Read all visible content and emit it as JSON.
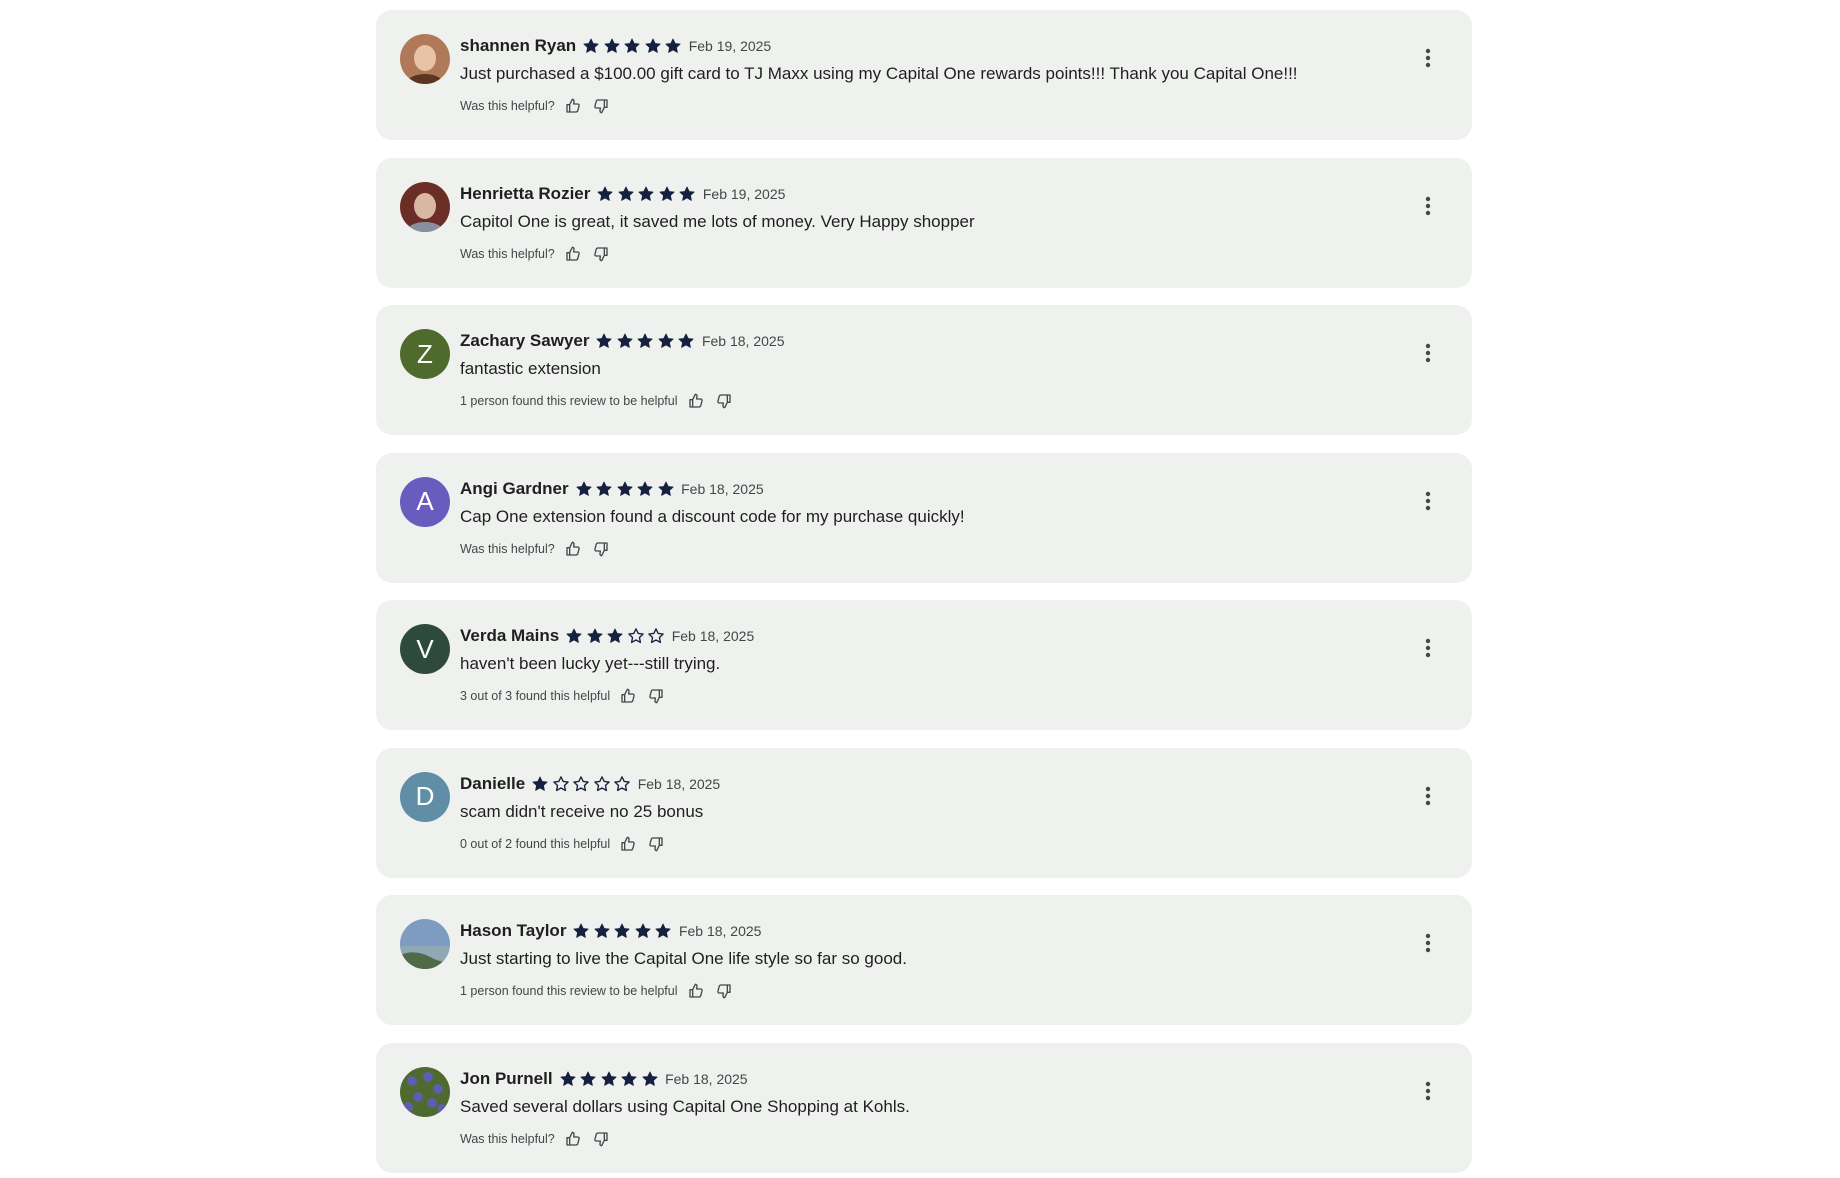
{
  "colors": {
    "card_background": "#eff1ef",
    "star_color": "#16213f",
    "text_primary": "#1f1f1f",
    "text_secondary": "#444746"
  },
  "reviews": [
    {
      "name": "shannen Ryan",
      "rating": 5,
      "date": "Feb 19, 2025",
      "text": "Just purchased a $100.00 gift card to TJ Maxx using my Capital One rewards points!!!  Thank you Capital One!!!",
      "helpful": "Was this helpful?",
      "avatar": {
        "type": "photo",
        "label": "woman-portrait",
        "bg": "#b07a5a",
        "fg": "#5a3521"
      }
    },
    {
      "name": "Henrietta Rozier",
      "rating": 5,
      "date": "Feb 19, 2025",
      "text": "Capitol One is great, it saved me lots of money. Very Happy shopper",
      "helpful": "Was this helpful?",
      "avatar": {
        "type": "photo",
        "label": "older-woman-portrait",
        "bg": "#6b2e26",
        "fg": "#d9b8a3"
      }
    },
    {
      "name": "Zachary Sawyer",
      "rating": 5,
      "date": "Feb 18, 2025",
      "text": "fantastic extension",
      "helpful": "1 person found this review to be helpful",
      "avatar": {
        "type": "letter",
        "letter": "Z",
        "bg": "#4e6b2d"
      }
    },
    {
      "name": "Angi Gardner",
      "rating": 5,
      "date": "Feb 18, 2025",
      "text": "Cap One extension found a discount code for my purchase quickly!",
      "helpful": "Was this helpful?",
      "avatar": {
        "type": "letter",
        "letter": "A",
        "bg": "#6a5bbf"
      }
    },
    {
      "name": "Verda Mains",
      "rating": 3,
      "date": "Feb 18, 2025",
      "text": "haven't been lucky yet---still trying.",
      "helpful": "3 out of 3 found this helpful",
      "avatar": {
        "type": "letter",
        "letter": "V",
        "bg": "#2e4a3c"
      }
    },
    {
      "name": "Danielle",
      "rating": 1,
      "date": "Feb 18, 2025",
      "text": "scam didn't receive no 25 bonus",
      "helpful": "0 out of 2 found this helpful",
      "avatar": {
        "type": "letter",
        "letter": "D",
        "bg": "#5f8ea6"
      }
    },
    {
      "name": "Hason Taylor",
      "rating": 5,
      "date": "Feb 18, 2025",
      "text": "Just starting to live the Capital One life style so far so good.",
      "helpful": "1 person found this review to be helpful",
      "avatar": {
        "type": "photo",
        "label": "landscape-photo",
        "bg": "#7e9cc2",
        "fg": "#4f6a45"
      }
    },
    {
      "name": "Jon Purnell",
      "rating": 5,
      "date": "Feb 18, 2025",
      "text": "Saved several dollars using Capital One Shopping at Kohls.",
      "helpful": "Was this helpful?",
      "avatar": {
        "type": "photo",
        "label": "flowers-photo",
        "bg": "#4e6a2e",
        "fg": "#5b5fae"
      }
    }
  ],
  "icons": {
    "thumb_up": "thumb-up-icon",
    "thumb_down": "thumb-down-icon",
    "more": "more-vert-icon",
    "star_full": "star-icon",
    "star_empty": "star-outline-icon"
  }
}
